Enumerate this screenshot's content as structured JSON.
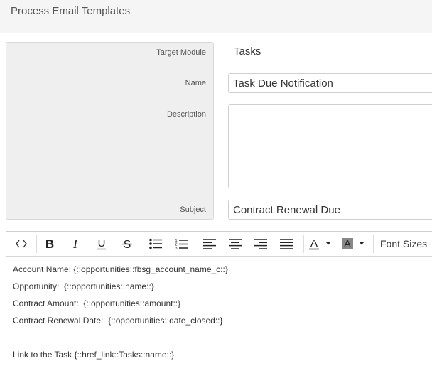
{
  "header": {
    "title": "Process Email Templates"
  },
  "form": {
    "target_module_label": "Target Module",
    "target_module_value": "Tasks",
    "name_label": "Name",
    "name_value": "Task Due Notification",
    "description_label": "Description",
    "description_value": "",
    "subject_label": "Subject",
    "subject_value": "Contract Renewal Due"
  },
  "toolbar": {
    "icons": [
      "code-view-icon",
      "bold-icon",
      "italic-icon",
      "underline-icon",
      "strikethrough-icon",
      "bullet-list-icon",
      "numbered-list-icon",
      "align-left-icon",
      "align-center-icon",
      "align-right-icon",
      "align-justify-icon",
      "text-color-icon",
      "background-color-icon"
    ],
    "font_sizes_label": "Font Sizes"
  },
  "body": {
    "lines": [
      "Account Name: {::opportunities::fbsg_account_name_c::}",
      "Opportunity:  {::opportunities::name::}",
      "Contract Amount:  {::opportunities::amount::}",
      "Contract Renewal Date:  {::opportunities::date_closed::}",
      "",
      "Link to the Task {::href_link::Tasks::name::}"
    ]
  }
}
